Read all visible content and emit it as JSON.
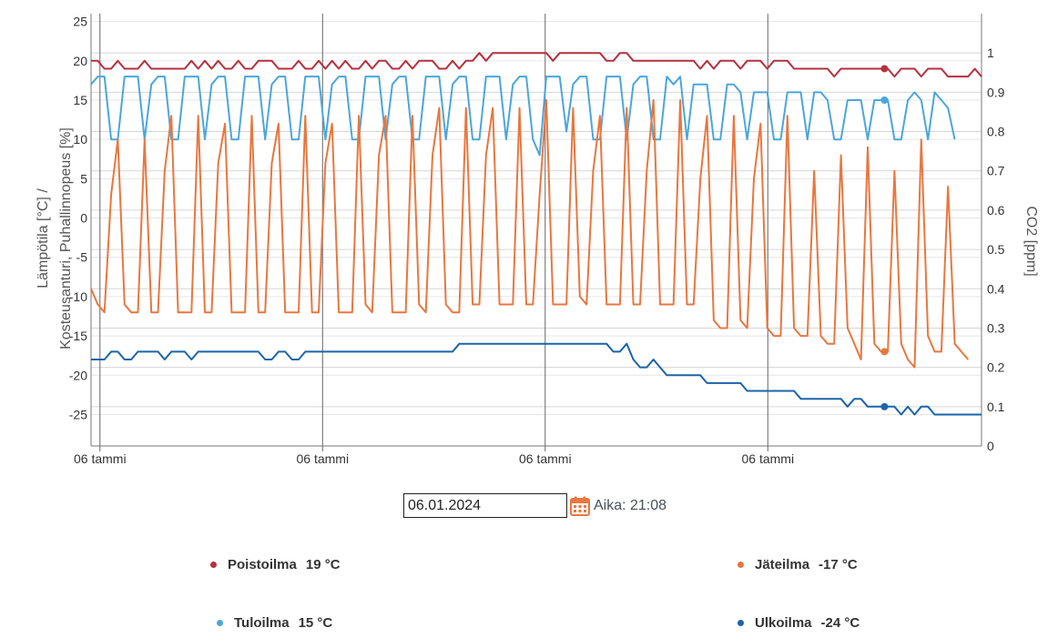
{
  "chart_data": {
    "type": "line",
    "left_axis": {
      "label_line1": "Lämpötila [°C] /",
      "label_line2": "Kosteusanturi, Puhallinnopeus [%]",
      "ylim": [
        -29,
        26
      ],
      "ticks": [
        25,
        20,
        15,
        10,
        5,
        0,
        -5,
        -10,
        -15,
        -20,
        -25
      ]
    },
    "right_axis": {
      "label": "CO2 [ppm]",
      "ylim": [
        0,
        1.1
      ],
      "ticks": [
        "0",
        "0.1",
        "0.2",
        "0.3",
        "0.4",
        "0.5",
        "0.6",
        "0.7",
        "0.8",
        "0.9",
        "1"
      ]
    },
    "x_tick_labels": [
      "06 tammi",
      "06 tammi",
      "06 tammi",
      "06 tammi"
    ],
    "grid": true,
    "series": [
      {
        "name": "Poistoilma",
        "color": "#b5303e",
        "values": [
          20,
          20,
          19,
          19,
          20,
          19,
          19,
          19,
          20,
          19,
          19,
          19,
          19,
          19,
          19,
          20,
          19,
          20,
          19,
          20,
          19,
          19,
          20,
          19,
          19,
          20,
          20,
          20,
          19,
          19,
          19,
          20,
          19,
          19,
          20,
          19,
          20,
          19,
          20,
          19,
          19,
          20,
          19,
          20,
          20,
          19,
          19,
          20,
          19,
          20,
          20,
          20,
          19,
          19,
          20,
          19,
          20,
          20,
          21,
          20,
          21,
          21,
          21,
          21,
          21,
          21,
          21,
          21,
          21,
          20,
          21,
          21,
          21,
          21,
          21,
          21,
          21,
          20,
          20,
          21,
          21,
          20,
          20,
          20,
          20,
          20,
          20,
          20,
          20,
          20,
          20,
          19,
          20,
          19,
          20,
          20,
          20,
          19,
          20,
          20,
          20,
          19,
          20,
          20,
          20,
          19,
          19,
          19,
          19,
          19,
          19,
          18,
          19,
          19,
          19,
          19,
          19,
          19,
          19,
          19,
          18,
          19,
          19,
          19,
          18,
          19,
          19,
          19,
          18,
          18,
          18,
          18,
          19,
          18
        ]
      },
      {
        "name": "Tuloilma",
        "color": "#4ba6dc",
        "values": [
          17,
          18,
          18,
          10,
          10,
          18,
          18,
          18,
          10,
          17,
          18,
          18,
          10,
          10,
          18,
          18,
          18,
          10,
          17,
          18,
          18,
          10,
          10,
          18,
          18,
          18,
          10,
          17,
          18,
          18,
          10,
          10,
          18,
          18,
          18,
          10,
          17,
          18,
          18,
          10,
          10,
          18,
          18,
          18,
          10,
          17,
          18,
          18,
          10,
          10,
          18,
          18,
          18,
          10,
          17,
          18,
          18,
          10,
          10,
          18,
          18,
          18,
          10,
          17,
          18,
          18,
          10,
          8,
          18,
          18,
          18,
          11,
          17,
          18,
          18,
          10,
          10,
          18,
          18,
          18,
          10,
          17,
          18,
          18,
          10,
          10,
          18,
          17,
          18,
          10,
          17,
          17,
          17,
          10,
          10,
          17,
          17,
          16,
          10,
          16,
          16,
          16,
          10,
          10,
          16,
          16,
          16,
          10,
          16,
          16,
          15,
          10,
          10,
          15,
          15,
          15,
          10,
          15,
          15,
          15,
          10,
          10,
          15,
          16,
          15,
          10,
          16,
          15,
          14,
          10
        ]
      },
      {
        "name": "Jäteilma",
        "color": "#e8773f",
        "values": [
          -9,
          -11,
          -12,
          3,
          10,
          -11,
          -12,
          -12,
          10,
          -12,
          -12,
          6,
          13,
          -12,
          -12,
          -12,
          13,
          -12,
          -12,
          7,
          12,
          -12,
          -12,
          -12,
          13,
          -12,
          -12,
          7,
          12,
          -12,
          -12,
          -12,
          13,
          -12,
          -12,
          7,
          12,
          -12,
          -12,
          -12,
          13,
          -11,
          -12,
          8,
          13,
          -12,
          -12,
          -12,
          13,
          -11,
          -12,
          8,
          14,
          -11,
          -12,
          -12,
          14,
          -11,
          -11,
          8,
          14,
          -11,
          -11,
          -11,
          14,
          -11,
          -11,
          3,
          15,
          -11,
          -11,
          -11,
          14,
          -10,
          -11,
          6,
          13,
          -11,
          -11,
          -11,
          14,
          -11,
          -11,
          6,
          15,
          -11,
          -11,
          -11,
          15,
          -11,
          -11,
          5,
          13,
          -13,
          -14,
          -14,
          13,
          -13,
          -14,
          5,
          12,
          -14,
          -15,
          -15,
          13,
          -14,
          -15,
          -15,
          6,
          -15,
          -16,
          -16,
          8,
          -14,
          -16,
          -18,
          9,
          -16,
          -17,
          -17,
          6,
          -16,
          -18,
          -19,
          10,
          -15,
          -17,
          -17,
          4,
          -16,
          -17,
          -18
        ]
      },
      {
        "name": "Ulkoilma",
        "color": "#1b64a8",
        "values": [
          -18,
          -18,
          -18,
          -17,
          -17,
          -18,
          -18,
          -17,
          -17,
          -17,
          -17,
          -18,
          -17,
          -17,
          -17,
          -18,
          -17,
          -17,
          -17,
          -17,
          -17,
          -17,
          -17,
          -17,
          -17,
          -17,
          -18,
          -18,
          -17,
          -17,
          -18,
          -18,
          -17,
          -17,
          -17,
          -17,
          -17,
          -17,
          -17,
          -17,
          -17,
          -17,
          -17,
          -17,
          -17,
          -17,
          -17,
          -17,
          -17,
          -17,
          -17,
          -17,
          -17,
          -17,
          -17,
          -16,
          -16,
          -16,
          -16,
          -16,
          -16,
          -16,
          -16,
          -16,
          -16,
          -16,
          -16,
          -16,
          -16,
          -16,
          -16,
          -16,
          -16,
          -16,
          -16,
          -16,
          -16,
          -16,
          -17,
          -17,
          -16,
          -18,
          -19,
          -19,
          -18,
          -19,
          -20,
          -20,
          -20,
          -20,
          -20,
          -20,
          -21,
          -21,
          -21,
          -21,
          -21,
          -21,
          -22,
          -22,
          -22,
          -22,
          -22,
          -22,
          -22,
          -22,
          -23,
          -23,
          -23,
          -23,
          -23,
          -23,
          -23,
          -24,
          -23,
          -23,
          -24,
          -24,
          -24,
          -24,
          -24,
          -25,
          -24,
          -25,
          -24,
          -24,
          -25,
          -25,
          -25,
          -25,
          -25,
          -25,
          -25,
          -25
        ]
      }
    ],
    "markers": [
      {
        "series": "Poistoilma",
        "value": 19
      },
      {
        "series": "Tuloilma",
        "value": 15
      },
      {
        "series": "Jäteilma",
        "value": -17
      },
      {
        "series": "Ulkoilma",
        "value": -24
      }
    ]
  },
  "date_picker": {
    "value": "06.01.2024",
    "time_label": "Aika: 21:08"
  },
  "legend": [
    {
      "name": "Poistoilma",
      "value": "19 °C",
      "color": "#b5303e"
    },
    {
      "name": "Jäteilma",
      "value": "-17 °C",
      "color": "#e8773f"
    },
    {
      "name": "Tuloilma",
      "value": "15 °C",
      "color": "#4ba6dc"
    },
    {
      "name": "Ulkoilma",
      "value": "-24 °C",
      "color": "#1b64a8"
    }
  ]
}
